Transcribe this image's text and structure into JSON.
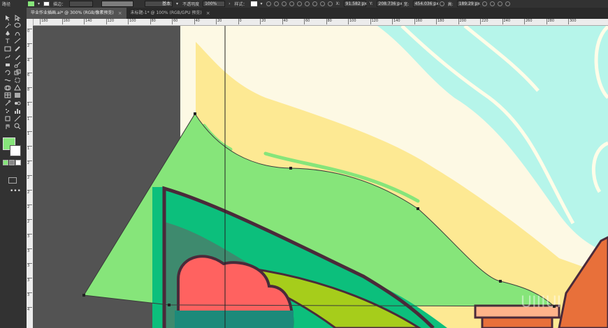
{
  "control_bar": {
    "object_type": "路径",
    "stroke_label": "描边：",
    "stroke_profile": "基本",
    "opacity_label": "不透明度",
    "opacity_value": "100%",
    "style_label": "样式：",
    "x_label": "X:",
    "x_value": "91.582 px",
    "y_label": "Y:",
    "y_value": "208.736 px",
    "w_label": "宽:",
    "w_value": "454.036 px",
    "h_label": "高:",
    "h_value": "189.29 px"
  },
  "tabs": [
    {
      "label": "毕业作业插画.ai* @ 300% (RGB/像素预览)",
      "close": "×"
    },
    {
      "label": "未标题-1* @ 100% (RGB/GPU 预览)",
      "close": "×"
    }
  ],
  "ruler": {
    "h_ticks": [
      "180",
      "160",
      "140",
      "120",
      "100",
      "80",
      "60",
      "40",
      "20",
      "0",
      "20",
      "40",
      "60",
      "80",
      "100",
      "120",
      "140",
      "160",
      "180",
      "200",
      "220",
      "240",
      "260",
      "280",
      "300"
    ],
    "v_ticks": [
      "0",
      "2",
      "4",
      "6",
      "8",
      "1",
      "1",
      "1",
      "1",
      "2",
      "2",
      "2",
      "2",
      "2",
      "3",
      "3",
      "3",
      "3",
      "3",
      "4"
    ]
  },
  "colors": {
    "fill": "#86e57a",
    "cream": "#fdf9e4",
    "yellow": "#fde993",
    "teal": "#b6f5ea",
    "dark_green": "#0cbf7c",
    "outline": "#4a2a3a",
    "salmon": "#ff6260",
    "lime": "#a6cd1b",
    "orange": "#e8703a"
  },
  "icons": [
    "selection-tool-icon",
    "direct-selection-tool-icon",
    "magic-wand-icon",
    "lasso-icon",
    "pen-tool-icon",
    "curvature-tool-icon",
    "type-tool-icon",
    "line-tool-icon",
    "rectangle-tool-icon",
    "paintbrush-icon",
    "shaper-tool-icon",
    "pencil-icon",
    "eraser-icon",
    "scissors-icon",
    "rotate-tool-icon",
    "scale-tool-icon",
    "width-tool-icon",
    "free-transform-icon",
    "shape-builder-icon",
    "perspective-grid-icon",
    "mesh-tool-icon",
    "gradient-tool-icon",
    "eyedropper-icon",
    "blend-tool-icon",
    "symbol-sprayer-icon",
    "column-graph-icon",
    "artboard-tool-icon",
    "slice-tool-icon",
    "hand-tool-icon",
    "zoom-tool-icon"
  ],
  "watermark": "UIIIUI"
}
